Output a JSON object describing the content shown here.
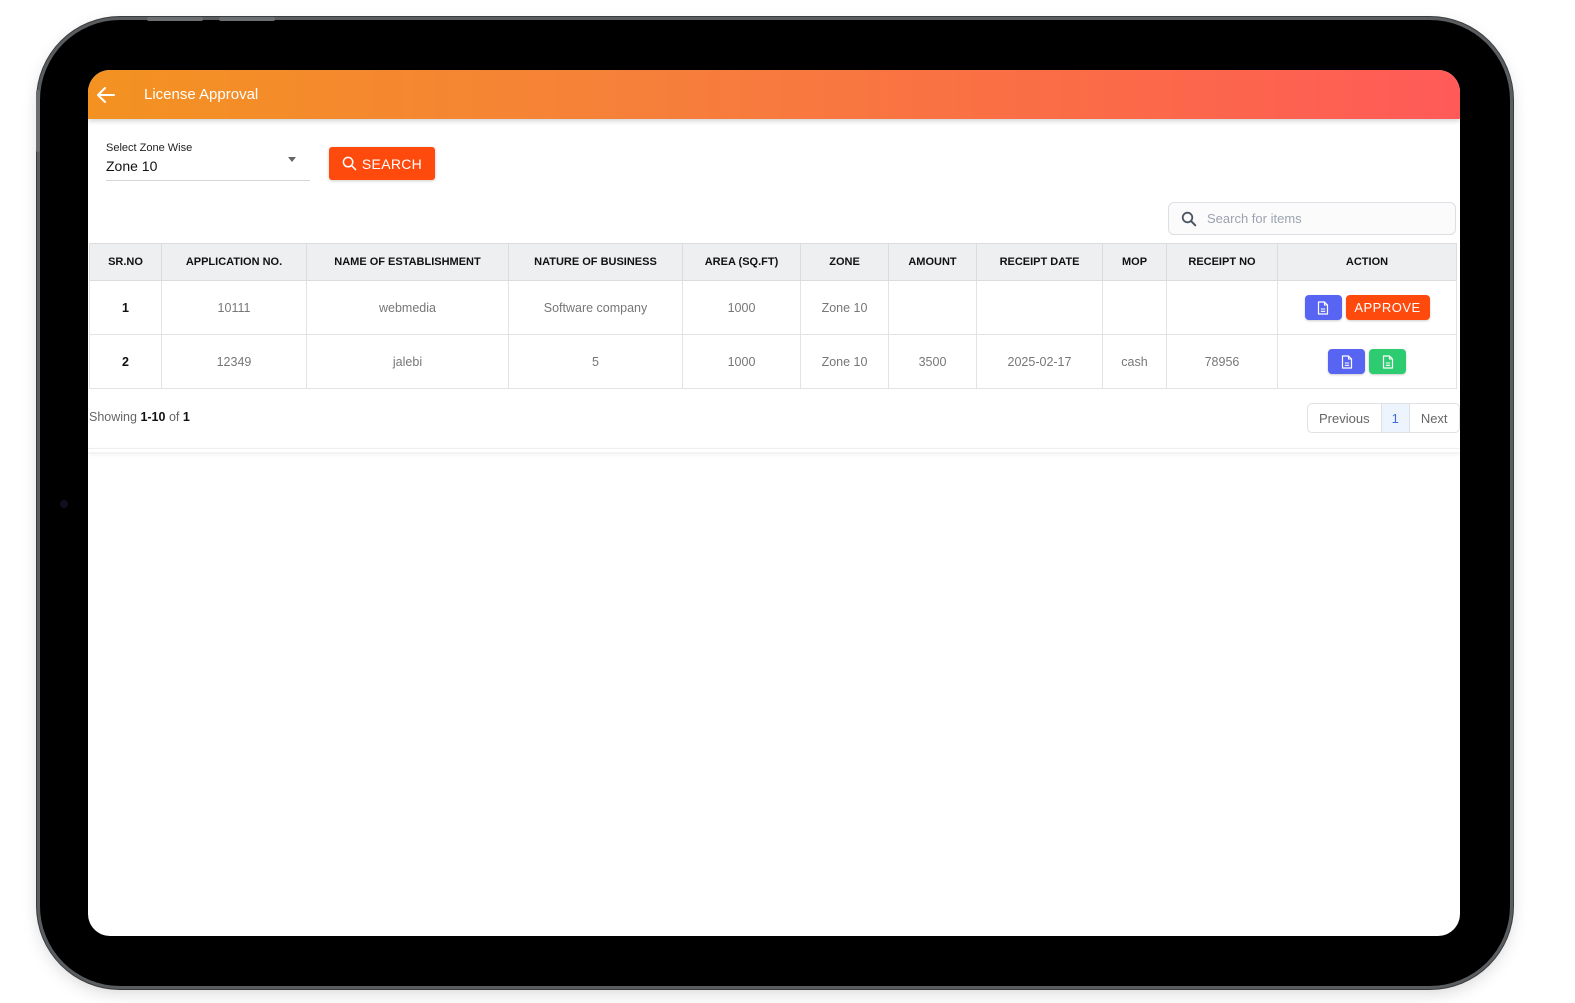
{
  "appbar": {
    "title": "License Approval",
    "back_icon": "arrow-left-icon"
  },
  "filters": {
    "zone_label": "Select Zone Wise",
    "zone_value": "Zone 10",
    "search_button": "SEARCH"
  },
  "table_search": {
    "placeholder": "Search for items",
    "value": ""
  },
  "table": {
    "columns": [
      "SR.NO",
      "APPLICATION NO.",
      "NAME OF ESTABLISHMENT",
      "NATURE OF BUSINESS",
      "AREA (SQ.FT)",
      "ZONE",
      "AMOUNT",
      "RECEIPT DATE",
      "MOP",
      "RECEIPT NO",
      "ACTION"
    ],
    "rows": [
      {
        "sr": "1",
        "application_no": "10111",
        "establishment": "webmedia",
        "business": "Software company",
        "area": "1000",
        "zone": "Zone 10",
        "amount": "",
        "receipt_date": "",
        "mop": "",
        "receipt_no": "",
        "actions": {
          "view_icon": "document-icon",
          "approve_label": "APPROVE"
        }
      },
      {
        "sr": "2",
        "application_no": "12349",
        "establishment": "jalebi",
        "business": "5",
        "area": "1000",
        "zone": "Zone 10",
        "amount": "3500",
        "receipt_date": "2025-02-17",
        "mop": "cash",
        "receipt_no": "78956",
        "actions": {
          "view_icon": "document-icon",
          "receipt_icon": "document-icon"
        }
      }
    ]
  },
  "footer": {
    "showing_prefix": "Showing",
    "range": "1-10",
    "of_word": "of",
    "total": "1"
  },
  "pagination": {
    "previous": "Previous",
    "current": "1",
    "next": "Next"
  },
  "colors": {
    "accent": "#ff4a0e",
    "header_gradient_start": "#f39221",
    "header_gradient_end": "#ff5a58",
    "view_button": "#5865f2",
    "receipt_button": "#2ecc71"
  }
}
